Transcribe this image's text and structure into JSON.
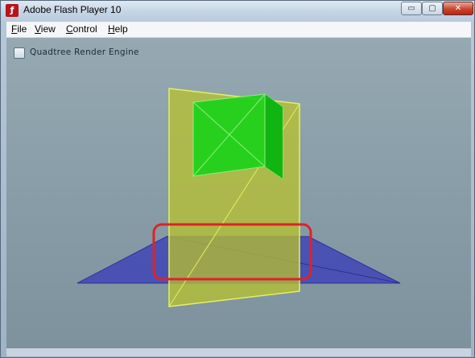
{
  "window": {
    "title": "Adobe Flash Player 10",
    "icon": "flash-player-icon",
    "controls": {
      "minimize_label": "▭",
      "maximize_label": "▢",
      "close_label": "✕"
    }
  },
  "menu": {
    "items": [
      {
        "label": "File",
        "accel": "F",
        "rest": "ile"
      },
      {
        "label": "View",
        "accel": "V",
        "rest": "iew"
      },
      {
        "label": "Control",
        "accel": "C",
        "rest": "ontrol"
      },
      {
        "label": "Help",
        "accel": "H",
        "rest": "elp"
      }
    ]
  },
  "stage": {
    "checkbox": {
      "label": "Quadtree Render Engine",
      "checked": false
    }
  },
  "colors": {
    "ground_plane": "#3f45b6",
    "vertical_plane": "#b8c22c",
    "cube": "#19d31a",
    "highlight": "#e0212a",
    "stage_bg": "#899ea8"
  }
}
